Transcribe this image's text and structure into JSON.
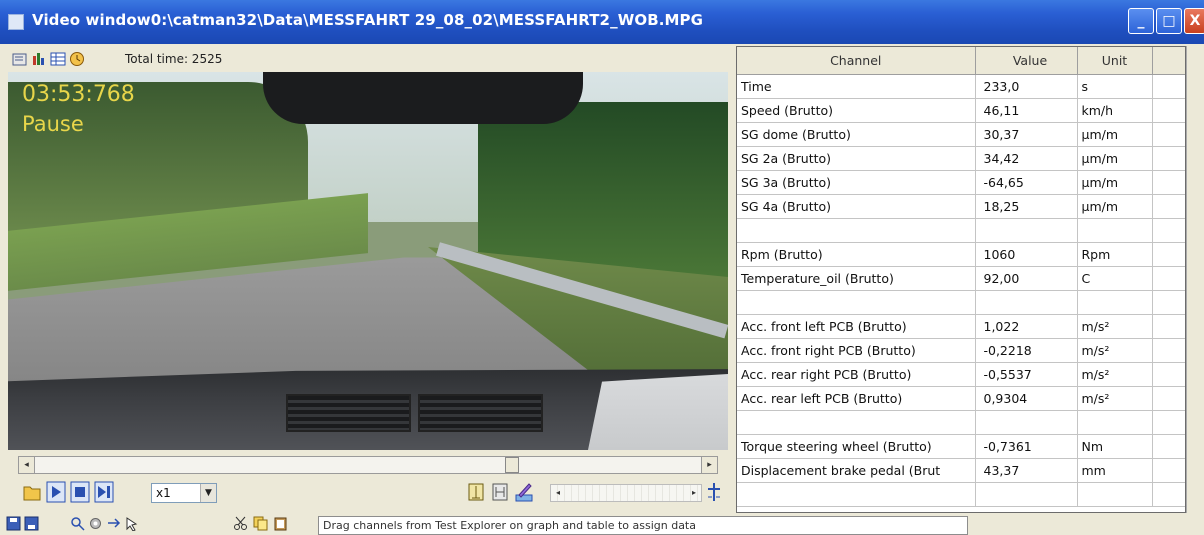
{
  "window": {
    "title": "Video window0:\\catman32\\Data\\MESSFAHRT 29_08_02\\MESSFAHRT2_WOB.MPG",
    "min_label": "_",
    "max_label": "□",
    "close_label": "X"
  },
  "video_toolbar": {
    "total_time_label": "Total time: 2525"
  },
  "video": {
    "osd_time": "03:53:768",
    "osd_status": "Pause"
  },
  "controls": {
    "speed_value": "x1",
    "seek_left": "◂",
    "seek_right": "▸",
    "mini_left": "◂",
    "mini_right": "▸"
  },
  "bottom_toolbar": {
    "hint": "Drag channels from Test Explorer on graph and table to assign data"
  },
  "table": {
    "headers": {
      "channel": "Channel",
      "value": "Value",
      "unit": "Unit"
    },
    "rows": [
      {
        "channel": "Time",
        "value": "233,0",
        "unit": "s"
      },
      {
        "channel": "Speed (Brutto)",
        "value": "46,11",
        "unit": "km/h"
      },
      {
        "channel": "SG dome (Brutto)",
        "value": "30,37",
        "unit": "µm/m"
      },
      {
        "channel": "SG 2a (Brutto)",
        "value": "34,42",
        "unit": "µm/m"
      },
      {
        "channel": "SG 3a (Brutto)",
        "value": "-64,65",
        "unit": "µm/m"
      },
      {
        "channel": "SG 4a (Brutto)",
        "value": "18,25",
        "unit": "µm/m"
      },
      {
        "channel": "",
        "value": "",
        "unit": ""
      },
      {
        "channel": "Rpm (Brutto)",
        "value": "1060",
        "unit": "Rpm"
      },
      {
        "channel": "Temperature_oil (Brutto)",
        "value": "92,00",
        "unit": "C"
      },
      {
        "channel": "",
        "value": "",
        "unit": ""
      },
      {
        "channel": "Acc. front left PCB (Brutto)",
        "value": "1,022",
        "unit": "m/s²"
      },
      {
        "channel": "Acc. front right PCB (Brutto)",
        "value": "-0,2218",
        "unit": "m/s²"
      },
      {
        "channel": "Acc. rear right PCB (Brutto)",
        "value": "-0,5537",
        "unit": "m/s²"
      },
      {
        "channel": "Acc. rear left PCB (Brutto)",
        "value": "0,9304",
        "unit": "m/s²"
      },
      {
        "channel": "",
        "value": "",
        "unit": ""
      },
      {
        "channel": "Torque steering wheel (Brutto)",
        "value": "-0,7361",
        "unit": "Nm"
      },
      {
        "channel": "Displacement brake pedal (Brut",
        "value": "43,37",
        "unit": "mm"
      },
      {
        "channel": "",
        "value": "",
        "unit": ""
      }
    ]
  }
}
